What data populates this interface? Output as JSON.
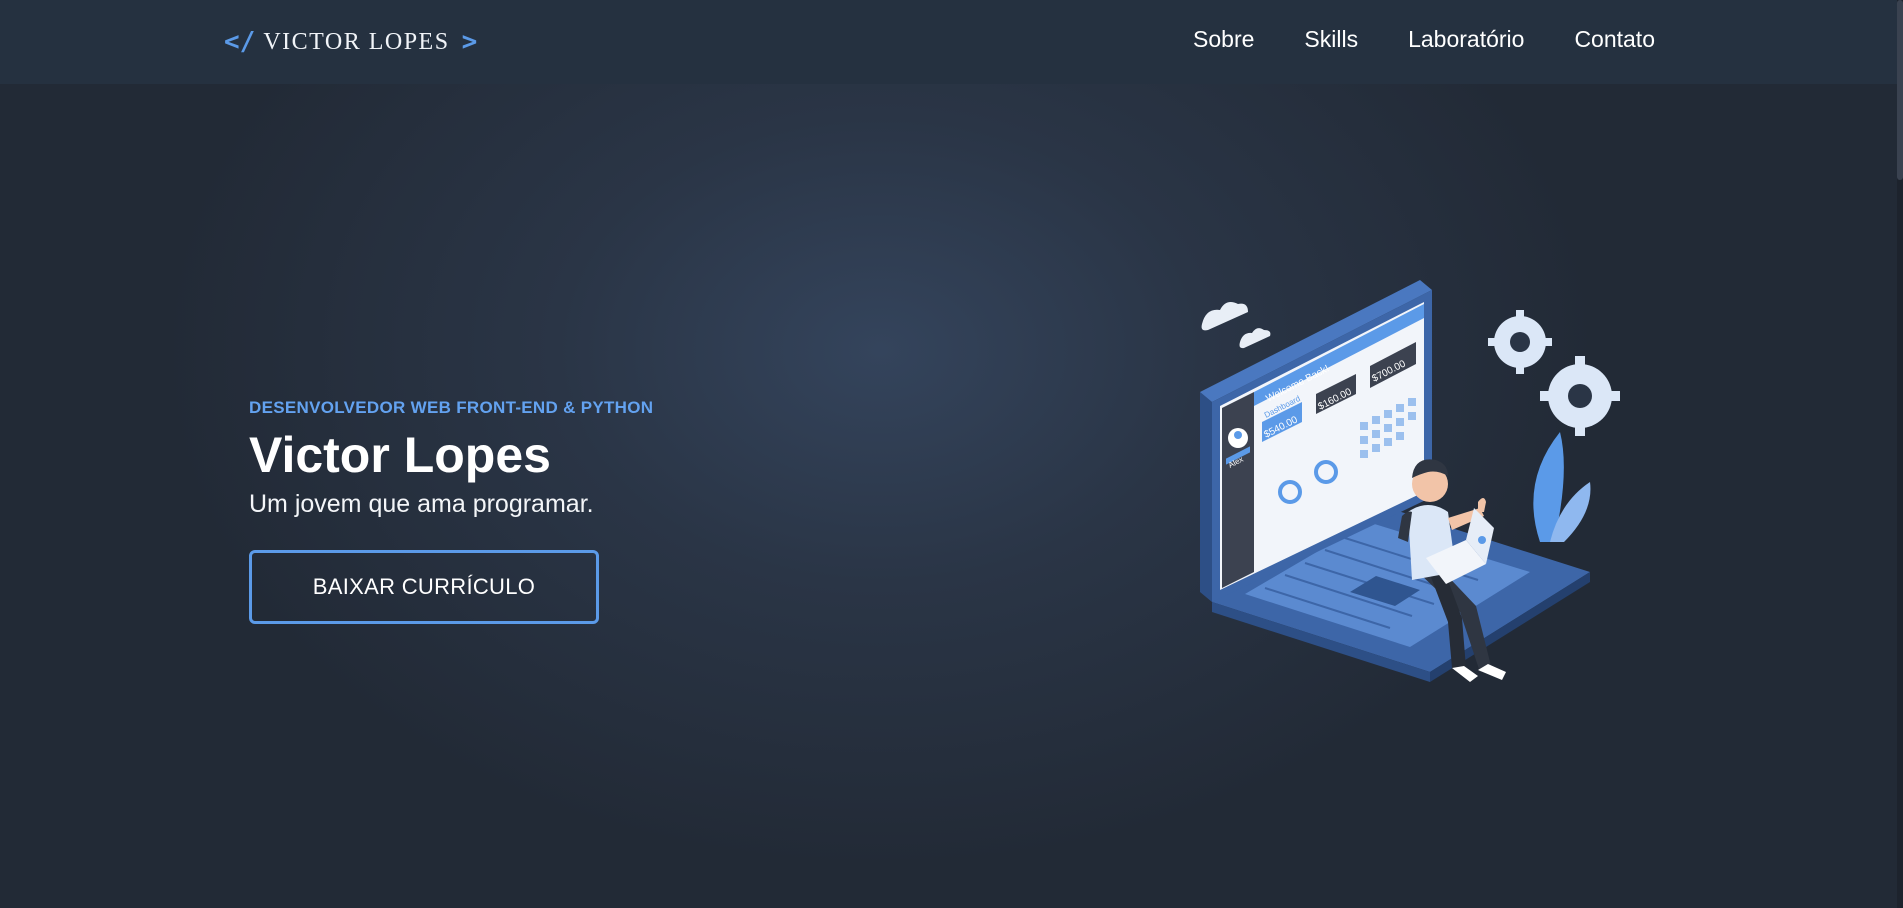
{
  "header": {
    "logo_open": "</",
    "logo_text": "VICTOR LOPES",
    "logo_close": ">",
    "nav": [
      "Sobre",
      "Skills",
      "Laboratório",
      "Contato"
    ]
  },
  "hero": {
    "eyebrow": "DESENVOLVEDOR WEB FRONT-END & PYTHON",
    "title": "Victor Lopes",
    "subtitle": "Um jovem que ama programar.",
    "cta_label": "BAIXAR CURRÍCULO"
  },
  "illustration": {
    "welcome": "Welcome Back!",
    "dashboard": "Dashboard",
    "user": "Alex",
    "amount_1": "$540.00",
    "amount_2": "$160.00",
    "amount_3": "$700.00"
  },
  "colors": {
    "accent": "#5b9ae8",
    "background": "#222a36",
    "header": "#253140"
  }
}
